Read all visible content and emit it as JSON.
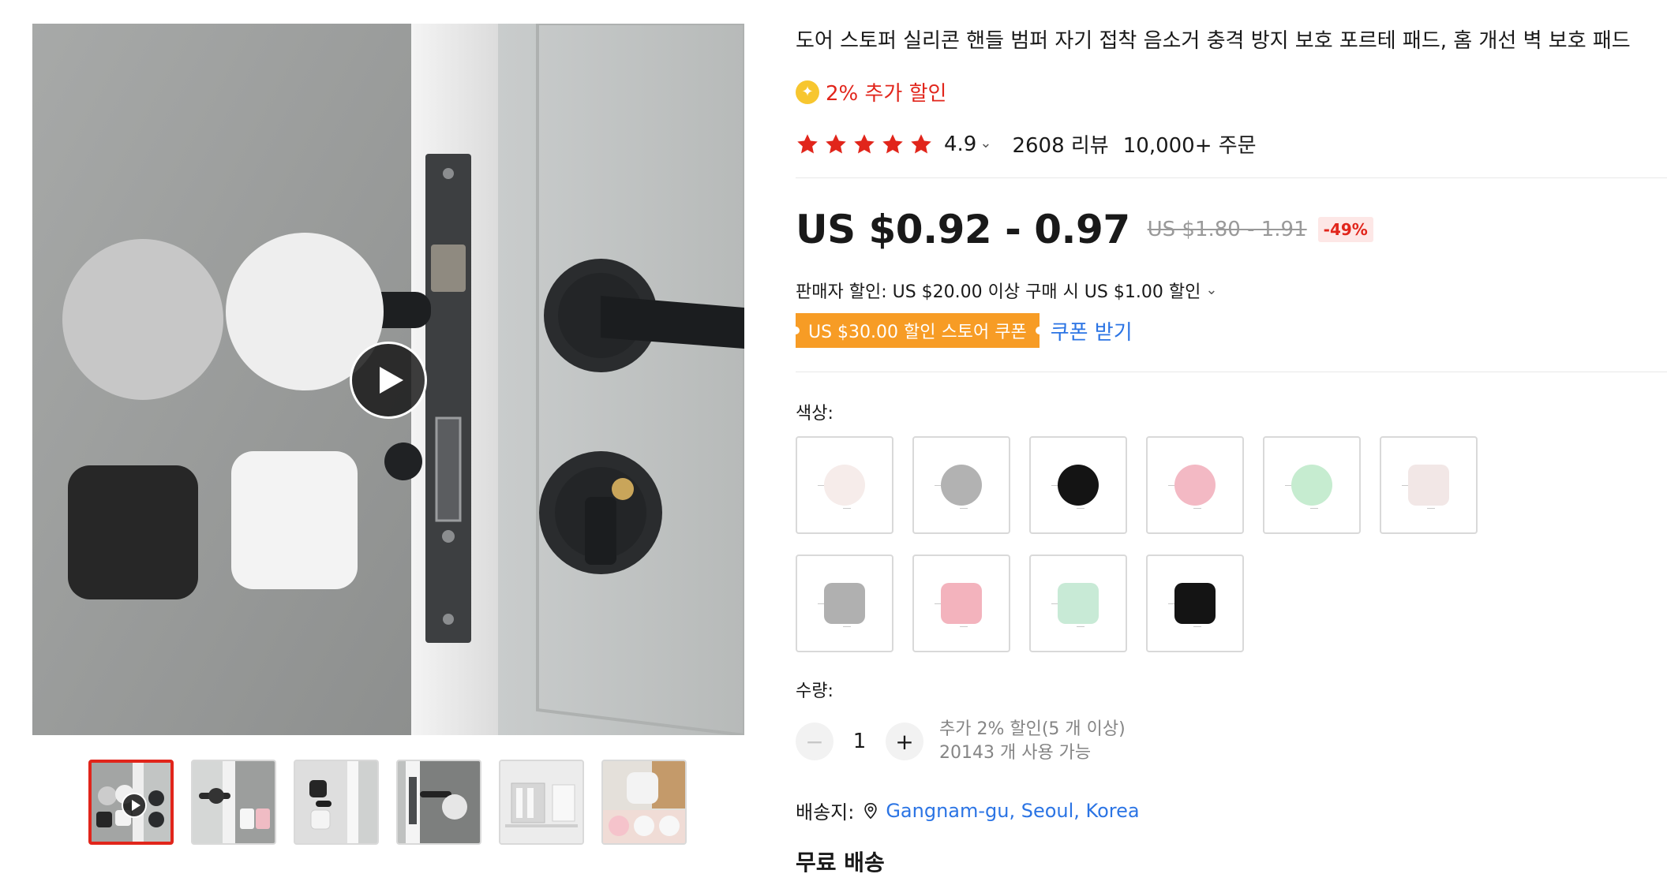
{
  "product": {
    "title": "도어 스토퍼 실리콘 핸들 범퍼 자기 접착 음소거 충격 방지 보호 포르테 패드, 홈 개선 벽 보호 패드",
    "extra_discount": "2% 추가 할인",
    "rating": "4.9",
    "reviews": "2608 리뷰",
    "orders": "10,000+ 주문",
    "stars_count": 5
  },
  "price": {
    "current": "US $0.92 - 0.97",
    "original": "US $1.80 - 1.91",
    "discount_badge": "-49%"
  },
  "seller_discount": "판매자 할인: US $20.00 이상 구매 시 US $1.00 할인",
  "coupon": {
    "label": "US $30.00 할인 스토어 쿠폰",
    "action": "쿠폰 받기"
  },
  "color_section": {
    "label": "색상:",
    "options": [
      {
        "shape": "circle",
        "color": "#f6ecea"
      },
      {
        "shape": "circle",
        "color": "#b2b2b2"
      },
      {
        "shape": "circle",
        "color": "#141414"
      },
      {
        "shape": "circle",
        "color": "#f3b9c4"
      },
      {
        "shape": "circle",
        "color": "#c6ecd0"
      },
      {
        "shape": "square",
        "color": "#f2e7e6"
      },
      {
        "shape": "square",
        "color": "#b0b0b0"
      },
      {
        "shape": "square",
        "color": "#f3b3bd"
      },
      {
        "shape": "square",
        "color": "#c8ead6"
      },
      {
        "shape": "square",
        "color": "#141414"
      }
    ]
  },
  "quantity": {
    "label": "수량:",
    "minus": "−",
    "value": "1",
    "plus": "+",
    "note_discount": "추가 2% 할인(5 개 이상)",
    "note_available": "20143 개 사용 가능"
  },
  "shipping": {
    "label": "배송지:",
    "location": "Gangnam-gu, Seoul, Korea",
    "free": "무료 배송"
  },
  "gallery": {
    "thumbnail_count": 6,
    "active_index": 0
  },
  "colors": {
    "accent_red": "#e1251b",
    "link_blue": "#2b74e4",
    "coupon_orange": "#f79c25",
    "star_red": "#e1251b"
  }
}
